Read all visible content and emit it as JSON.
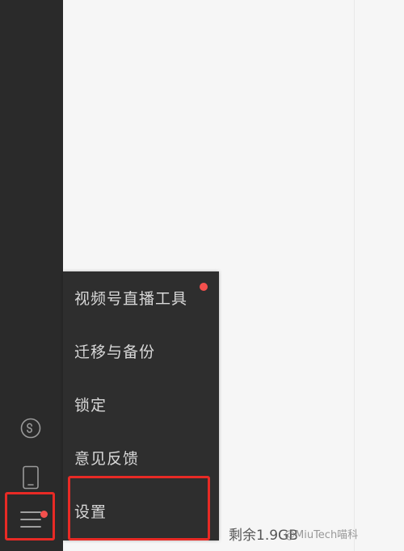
{
  "menu": {
    "items": [
      {
        "label": "视频号直播工具",
        "has_badge": true
      },
      {
        "label": "迁移与备份"
      },
      {
        "label": "锁定"
      },
      {
        "label": "意见反馈"
      },
      {
        "label": "设置",
        "highlighted": true
      }
    ]
  },
  "sidebar": {
    "icons": [
      "mini-program-icon",
      "phone-icon",
      "menu-icon"
    ],
    "menu_icon_has_badge": true
  },
  "status": {
    "storage_remaining": "剩余1.9GB"
  },
  "watermark": {
    "text": "@MiuTech喵科"
  },
  "colors": {
    "sidebar_bg": "#2a2a2a",
    "popup_bg": "#2e2e2e",
    "badge": "#f4504d",
    "highlight_border": "#e82a25",
    "main_bg": "#f6f6f6"
  }
}
